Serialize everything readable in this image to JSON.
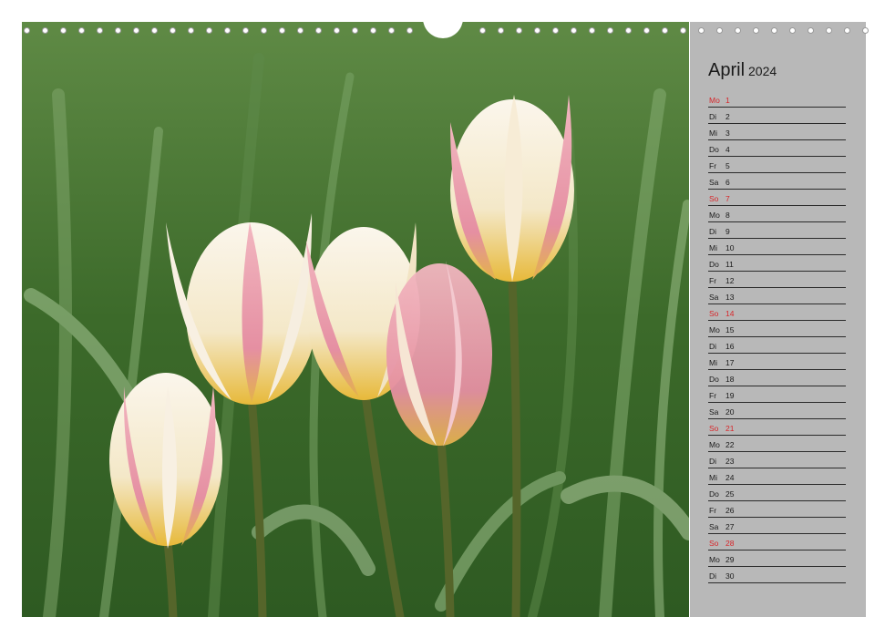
{
  "calendar": {
    "month": "April",
    "year": "2024",
    "accent_color": "#d7262a",
    "days": [
      {
        "weekday": "Mo",
        "day": "1",
        "holiday": true
      },
      {
        "weekday": "Di",
        "day": "2",
        "holiday": false
      },
      {
        "weekday": "Mi",
        "day": "3",
        "holiday": false
      },
      {
        "weekday": "Do",
        "day": "4",
        "holiday": false
      },
      {
        "weekday": "Fr",
        "day": "5",
        "holiday": false
      },
      {
        "weekday": "Sa",
        "day": "6",
        "holiday": false
      },
      {
        "weekday": "So",
        "day": "7",
        "holiday": true
      },
      {
        "weekday": "Mo",
        "day": "8",
        "holiday": false
      },
      {
        "weekday": "Di",
        "day": "9",
        "holiday": false
      },
      {
        "weekday": "Mi",
        "day": "10",
        "holiday": false
      },
      {
        "weekday": "Do",
        "day": "11",
        "holiday": false
      },
      {
        "weekday": "Fr",
        "day": "12",
        "holiday": false
      },
      {
        "weekday": "Sa",
        "day": "13",
        "holiday": false
      },
      {
        "weekday": "So",
        "day": "14",
        "holiday": true
      },
      {
        "weekday": "Mo",
        "day": "15",
        "holiday": false
      },
      {
        "weekday": "Di",
        "day": "16",
        "holiday": false
      },
      {
        "weekday": "Mi",
        "day": "17",
        "holiday": false
      },
      {
        "weekday": "Do",
        "day": "18",
        "holiday": false
      },
      {
        "weekday": "Fr",
        "day": "19",
        "holiday": false
      },
      {
        "weekday": "Sa",
        "day": "20",
        "holiday": false
      },
      {
        "weekday": "So",
        "day": "21",
        "holiday": true
      },
      {
        "weekday": "Mo",
        "day": "22",
        "holiday": false
      },
      {
        "weekday": "Di",
        "day": "23",
        "holiday": false
      },
      {
        "weekday": "Mi",
        "day": "24",
        "holiday": false
      },
      {
        "weekday": "Do",
        "day": "25",
        "holiday": false
      },
      {
        "weekday": "Fr",
        "day": "26",
        "holiday": false
      },
      {
        "weekday": "Sa",
        "day": "27",
        "holiday": false
      },
      {
        "weekday": "So",
        "day": "28",
        "holiday": true
      },
      {
        "weekday": "Mo",
        "day": "29",
        "holiday": false
      },
      {
        "weekday": "Di",
        "day": "30",
        "holiday": false
      }
    ]
  },
  "photo": {
    "subject": "tulips",
    "colors": {
      "background": "#3d6e2a",
      "petal": "#f6efe0",
      "blush": "#e58fa2",
      "base": "#e8bb3c",
      "stem": "#5a6a2a"
    }
  }
}
